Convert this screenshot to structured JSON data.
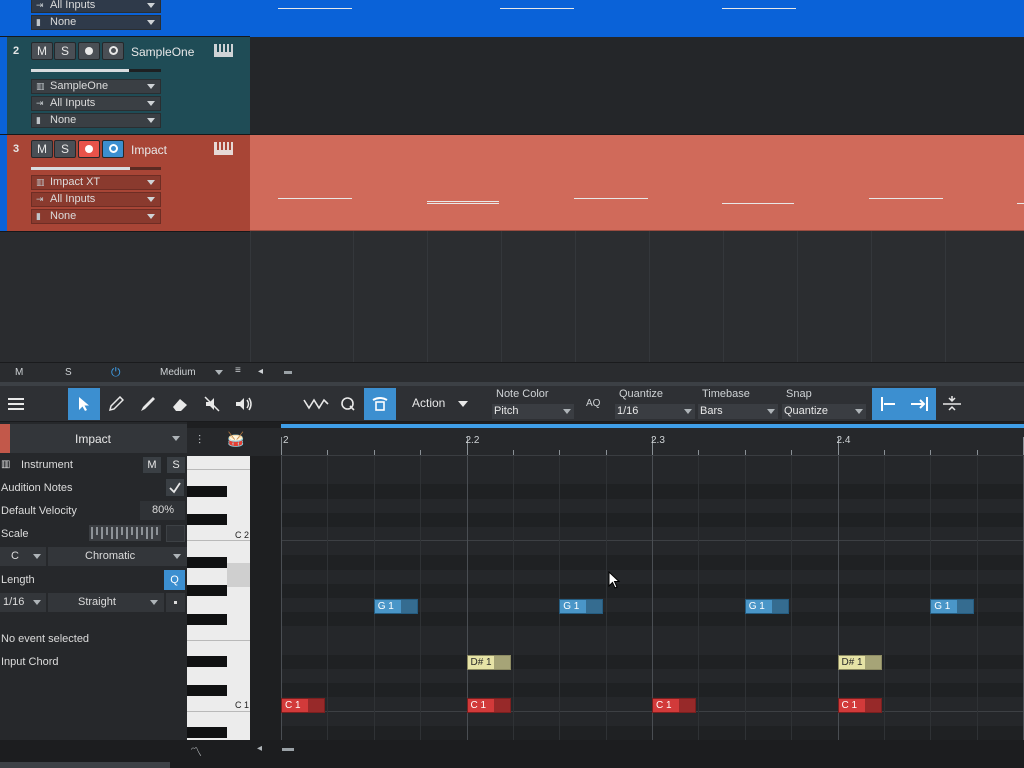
{
  "tracks": [
    {
      "number": "",
      "name": "",
      "instrument": "",
      "input": "All Inputs",
      "output": "None",
      "color": "#0a62d8"
    },
    {
      "number": "2",
      "name": "SampleOne",
      "instrument": "SampleOne",
      "input": "All Inputs",
      "output": "None",
      "color": "#245762",
      "volume": 0.75
    },
    {
      "number": "3",
      "name": "Impact",
      "instrument": "Impact XT",
      "input": "All Inputs",
      "output": "None",
      "color": "#c2584a",
      "volume": 0.76
    }
  ],
  "track_buttons": {
    "mute": "M",
    "solo": "S"
  },
  "arrange_footer": {
    "m": "M",
    "s": "S",
    "zoom": "Medium"
  },
  "toolbar": {
    "action_label": "Action",
    "note_color_label": "Note Color",
    "note_color_value": "Pitch",
    "aq_label": "AQ",
    "quantize_label": "Quantize",
    "quantize_value": "1/16",
    "timebase_label": "Timebase",
    "timebase_value": "Bars",
    "snap_label": "Snap",
    "snap_value": "Quantize"
  },
  "inspector": {
    "track_name": "Impact",
    "instrument_label": "Instrument",
    "m": "M",
    "s": "S",
    "audition_label": "Audition Notes",
    "audition_checked": true,
    "velocity_label": "Default Velocity",
    "velocity_value": "80%",
    "scale_label": "Scale",
    "scale_root": "C",
    "scale_type": "Chromatic",
    "length_label": "Length",
    "length_q": "Q",
    "length_value": "1/16",
    "length_mode": "Straight",
    "no_event": "No event selected",
    "input_chord": "Input Chord"
  },
  "piano": {
    "labels": [
      "C 2",
      "C 1"
    ]
  },
  "ruler": {
    "marks": [
      "2",
      "2.2",
      "2.3",
      "2.4"
    ]
  },
  "notes": [
    {
      "label": "G 1",
      "pitch": "G",
      "beat": 1.5
    },
    {
      "label": "G 1",
      "pitch": "G",
      "beat": 2.5
    },
    {
      "label": "G 1",
      "pitch": "G",
      "beat": 3.5
    },
    {
      "label": "G 1",
      "pitch": "G",
      "beat": 4.5
    },
    {
      "label": "D# 1",
      "pitch": "D#",
      "beat": 2.0
    },
    {
      "label": "D# 1",
      "pitch": "D#",
      "beat": 4.0
    },
    {
      "label": "C 1",
      "pitch": "C",
      "beat": 1.0
    },
    {
      "label": "C 1",
      "pitch": "C",
      "beat": 2.0
    },
    {
      "label": "C 1",
      "pitch": "C",
      "beat": 3.0
    },
    {
      "label": "C 1",
      "pitch": "C",
      "beat": 4.0
    }
  ],
  "note_colors": {
    "G": "#4a96c8",
    "D#": "#e6e3a6",
    "C": "#d23a3a"
  },
  "colors": {
    "accent": "#3c8fd0",
    "record": "#e8534a"
  }
}
